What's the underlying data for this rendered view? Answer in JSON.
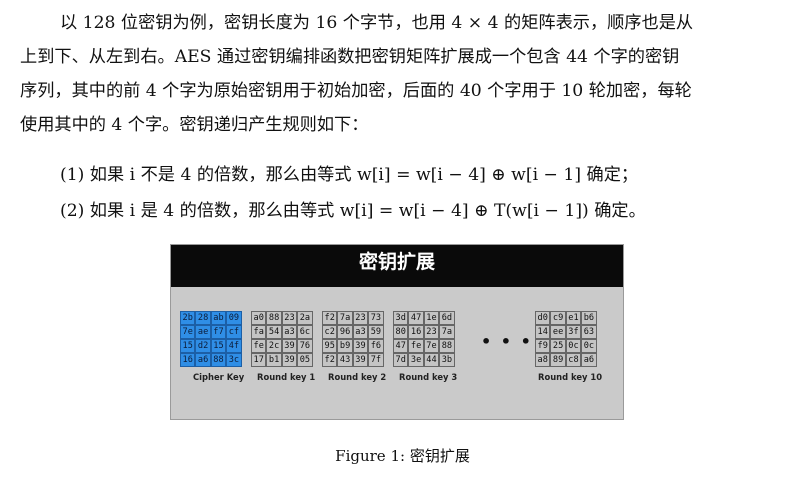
{
  "text": {
    "line1": "以 128 位密钥为例，密钥长度为 16 个字节，也用 4 × 4 的矩阵表示，顺序也是从",
    "line2": "上到下、从左到右。AES 通过密钥编排函数把密钥矩阵扩展成一个包含 44 个字的密钥",
    "line3": "序列，其中的前 4 个字为原始密钥用于初始加密，后面的 40 个字用于 10 轮加密，每轮",
    "line4": "使用其中的 4 个字。密钥递归产生规则如下：",
    "rule1": "(1) 如果 i 不是 4 的倍数，那么由等式 w[i] = w[i − 4] ⊕ w[i − 1] 确定；",
    "rule2": "(2) 如果 i 是 4 的倍数，那么由等式 w[i] = w[i − 4] ⊕ T(w[i − 1]) 确定。"
  },
  "figure": {
    "title": "密钥扩展",
    "caption": "Figure 1: 密钥扩展",
    "ellipsis": "• • •",
    "cipher_key": {
      "label": "Cipher Key",
      "rows": [
        [
          "2b",
          "28",
          "ab",
          "09"
        ],
        [
          "7e",
          "ae",
          "f7",
          "cf"
        ],
        [
          "15",
          "d2",
          "15",
          "4f"
        ],
        [
          "16",
          "a6",
          "88",
          "3c"
        ]
      ]
    },
    "round_key_1": {
      "label": "Round key 1",
      "rows": [
        [
          "a0",
          "88",
          "23",
          "2a"
        ],
        [
          "fa",
          "54",
          "a3",
          "6c"
        ],
        [
          "fe",
          "2c",
          "39",
          "76"
        ],
        [
          "17",
          "b1",
          "39",
          "05"
        ]
      ]
    },
    "round_key_2": {
      "label": "Round key 2",
      "rows": [
        [
          "f2",
          "7a",
          "23",
          "73"
        ],
        [
          "c2",
          "96",
          "a3",
          "59"
        ],
        [
          "95",
          "b9",
          "39",
          "f6"
        ],
        [
          "f2",
          "43",
          "39",
          "7f"
        ]
      ]
    },
    "round_key_3": {
      "label": "Round key 3",
      "rows": [
        [
          "3d",
          "47",
          "1e",
          "6d"
        ],
        [
          "80",
          "16",
          "23",
          "7a"
        ],
        [
          "47",
          "fe",
          "7e",
          "88"
        ],
        [
          "7d",
          "3e",
          "44",
          "3b"
        ]
      ]
    },
    "round_key_10": {
      "label": "Round key 10",
      "rows": [
        [
          "d0",
          "c9",
          "e1",
          "b6"
        ],
        [
          "14",
          "ee",
          "3f",
          "63"
        ],
        [
          "f9",
          "25",
          "0c",
          "0c"
        ],
        [
          "a8",
          "89",
          "c8",
          "a6"
        ]
      ]
    },
    "colors": {
      "header_bg": "#0a0a0a",
      "panel_bg": "#cacaca",
      "cipher_key_fill": "#2f8ee6"
    }
  }
}
